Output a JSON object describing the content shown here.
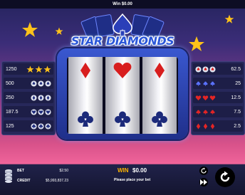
{
  "top_bar": {
    "label": "Win",
    "value": "$0.00"
  },
  "logo": {
    "text": "STAR DIAMONDS"
  },
  "paytable_left": [
    {
      "value": "1250",
      "symbol": "star"
    },
    {
      "value": "500",
      "symbol": "blue-spade"
    },
    {
      "value": "250",
      "symbol": "blue-diamond"
    },
    {
      "value": "187.5",
      "symbol": "blue-heart"
    },
    {
      "value": "125",
      "symbol": "blue-club"
    }
  ],
  "paytable_right": [
    {
      "value": "62.5",
      "symbol": "red-spade"
    },
    {
      "value": "25",
      "symbol": "blue-club"
    },
    {
      "value": "12.5",
      "symbol": "red-heart"
    },
    {
      "value": "7.5",
      "symbol": "red-club"
    },
    {
      "value": "2.5",
      "symbol": "red-diamond"
    }
  ],
  "reels": [
    {
      "top": "red-diamond",
      "bottom": "blue-club"
    },
    {
      "top": "red-heart",
      "bottom": "blue-club"
    },
    {
      "top": "red-diamond",
      "bottom": "blue-club"
    }
  ],
  "bottom_bar": {
    "bet_label": "BET",
    "bet_value": "$2.50",
    "credit_label": "CREDIT",
    "credit_value": "$5,993,837.23",
    "win_label": "WIN",
    "win_value": "$0.00",
    "prompt": "Please place your bet"
  },
  "icons": {
    "chip-stack": "chip-stack-icon",
    "autoplay": "autoplay-icon",
    "fast-forward": "fast-forward-icon",
    "spin": "spin-icon"
  },
  "colors": {
    "accent_gold": "#ffb400",
    "symbol_red": "#d81e1e",
    "symbol_blue": "#1c2a7a",
    "logo_blue": "#2a56d8"
  }
}
